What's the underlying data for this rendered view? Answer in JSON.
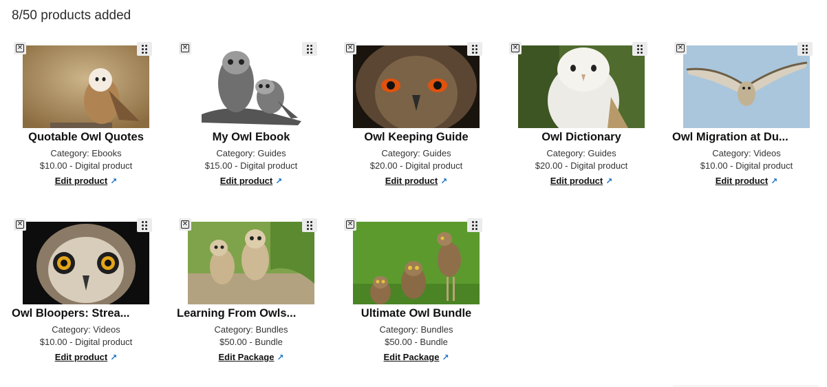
{
  "header": {
    "count_text": "8/50 products added"
  },
  "products": [
    {
      "title": "Quotable Owl Quotes",
      "category": "Category: Ebooks",
      "price": "$10.00 - Digital product",
      "edit_label": "Edit product",
      "image_icon": "barn-owl-photo"
    },
    {
      "title": "My Owl Ebook",
      "category": "Category: Guides",
      "price": "$15.00 - Digital product",
      "edit_label": "Edit product",
      "image_icon": "owl-engraving-illustration"
    },
    {
      "title": "Owl Keeping Guide",
      "category": "Category: Guides",
      "price": "$20.00 - Digital product",
      "edit_label": "Edit product",
      "image_icon": "eagle-owl-eyes-photo"
    },
    {
      "title": "Owl Dictionary",
      "category": "Category: Guides",
      "price": "$20.00 - Digital product",
      "edit_label": "Edit product",
      "image_icon": "white-owl-photo"
    },
    {
      "title": "Owl Migration at Du...",
      "category": "Category: Videos",
      "price": "$10.00 - Digital product",
      "edit_label": "Edit product",
      "image_icon": "flying-owl-photo"
    },
    {
      "title": "Owl Bloopers: Strea...",
      "category": "Category: Videos",
      "price": "$10.00 - Digital product",
      "edit_label": "Edit product",
      "image_icon": "horned-owl-face-photo"
    },
    {
      "title": "Learning From Owls...",
      "category": "Category: Bundles",
      "price": "$50.00 - Bundle",
      "edit_label": "Edit Package",
      "image_icon": "owlets-photo"
    },
    {
      "title": "Ultimate Owl Bundle",
      "category": "Category: Bundles",
      "price": "$50.00 - Bundle",
      "edit_label": "Edit Package",
      "image_icon": "burrowing-owls-photo"
    }
  ],
  "colors": {
    "link_arrow": "#1a73c2",
    "button_bg": "#ececec",
    "text": "#111111"
  }
}
